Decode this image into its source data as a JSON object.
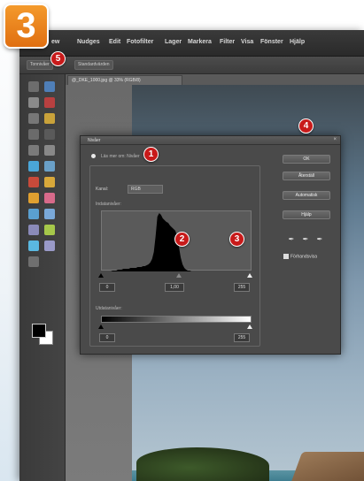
{
  "step_number": "3",
  "menu": {
    "items": [
      "ew",
      "Nudges",
      "Edit",
      "Fotofilter",
      "Lager",
      "Markera",
      "Filter",
      "Visa",
      "Fönster",
      "Hjälp"
    ]
  },
  "options_bar": {
    "left_label": "Tonnivåer",
    "right_label": "Standardvärden"
  },
  "document": {
    "tab_label": "@_DKE_1000.jpg @ 33% (RGB/8)"
  },
  "dialog": {
    "title": "Nivåer",
    "help_text": "Läs mer om: Nivåer",
    "channel_label": "Kanal:",
    "channel_value": "RGB",
    "input_levels_label": "Indatanivåer:",
    "input_black": "0",
    "input_gray": "1,00",
    "input_white": "255",
    "output_levels_label": "Utdatanivåer:",
    "output_black": "0",
    "output_white": "255",
    "buttons": {
      "ok": "OK",
      "reset": "Återställ",
      "auto": "Automatisk",
      "help": "Hjälp"
    },
    "preview_label": "Förhandsvisa"
  },
  "markers": [
    "1",
    "2",
    "3",
    "4",
    "5"
  ],
  "histogram": {
    "profile": [
      0,
      0,
      0,
      0,
      0,
      0,
      1,
      1,
      1,
      2,
      2,
      2,
      3,
      3,
      3,
      3,
      4,
      4,
      4,
      4,
      5,
      5,
      5,
      6,
      6,
      7,
      8,
      10,
      14,
      22,
      40,
      62,
      66,
      64,
      60,
      58,
      56,
      55,
      52,
      50,
      48,
      46,
      40,
      28,
      16,
      8,
      4,
      2,
      1,
      1,
      0,
      0,
      0,
      0,
      0,
      0,
      0,
      0,
      0,
      0,
      0,
      0,
      0,
      0,
      0,
      0,
      0,
      0,
      0,
      0,
      0,
      0,
      0,
      0,
      0,
      0,
      0,
      0,
      0,
      0,
      0,
      0,
      0,
      0,
      0
    ]
  },
  "colors": {
    "accent_orange": "#ee8420",
    "marker_red": "#c81a1a"
  }
}
